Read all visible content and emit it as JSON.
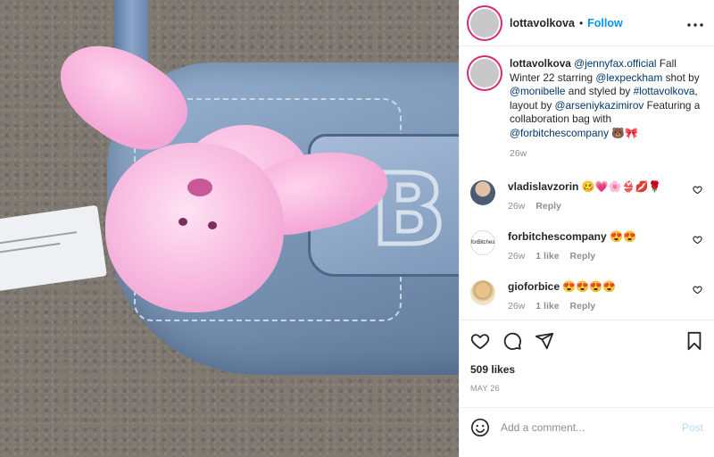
{
  "photo": {
    "alt": ""
  },
  "header": {
    "username": "lottavolkova",
    "separator": "•",
    "follow_label": "Follow",
    "more_label": "•••"
  },
  "caption": {
    "username": "lottavolkova",
    "parts": [
      {
        "text": "@jennyfax.official",
        "link": true
      },
      {
        "text": " Fall Winter 22 starring ",
        "link": false
      },
      {
        "text": "@lexpeckham",
        "link": true
      },
      {
        "text": " shot by ",
        "link": false
      },
      {
        "text": "@monibelle",
        "link": true
      },
      {
        "text": " and styled by ",
        "link": false
      },
      {
        "text": "#lottavolkova",
        "link": true
      },
      {
        "text": ", layout by ",
        "link": false
      },
      {
        "text": "@arseniykazimirov",
        "link": true
      },
      {
        "text": " Featuring a collaboration bag with ",
        "link": false
      },
      {
        "text": "@forbitchescompany",
        "link": true
      },
      {
        "text": " 🐻🎀",
        "link": false
      }
    ],
    "time": "26w"
  },
  "comments": [
    {
      "username": "vladislavzorin",
      "text": "🥴💗🌸👙💋🌹",
      "time": "26w",
      "likes": "",
      "reply": "Reply",
      "avatar": "vlad"
    },
    {
      "username": "forbitchescompany",
      "text": "😍😍",
      "time": "26w",
      "likes": "1 like",
      "reply": "Reply",
      "avatar": "forb",
      "avatar_text": "forBitches"
    },
    {
      "username": "gioforbice",
      "text": "😍😍😍😍",
      "time": "26w",
      "likes": "1 like",
      "reply": "Reply",
      "avatar": "gio"
    }
  ],
  "actions": {
    "likes": "509 likes",
    "date": "MAY 26"
  },
  "add_comment": {
    "placeholder": "Add a comment...",
    "post_label": "Post"
  },
  "colors": {
    "follow": "#0095f6",
    "post_disabled": "#b2dffc",
    "story_ring": "#d62976"
  }
}
